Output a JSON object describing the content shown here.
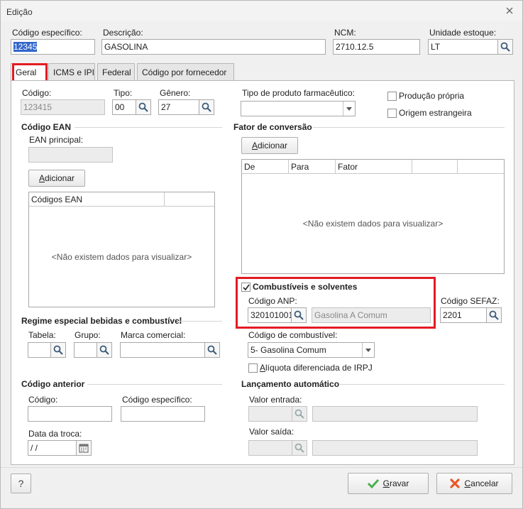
{
  "window": {
    "title": "Edição"
  },
  "header": {
    "codigo_especifico": {
      "label": "Código específico:",
      "value": "12345"
    },
    "descricao": {
      "label": "Descrição:",
      "value": "GASOLINA"
    },
    "ncm": {
      "label": "NCM:",
      "value": "2710.12.5"
    },
    "unidade_estoque": {
      "label": "Unidade estoque:",
      "value": "LT"
    }
  },
  "tabs": [
    {
      "label": "Geral"
    },
    {
      "label": "ICMS e IPI"
    },
    {
      "label": "Federal"
    },
    {
      "label": "Código por fornecedor"
    }
  ],
  "geral": {
    "codigo": {
      "label": "Código:",
      "value": "123415"
    },
    "tipo": {
      "label": "Tipo:",
      "value": "00"
    },
    "genero": {
      "label": "Gênero:",
      "value": "27"
    },
    "tipo_farmaceutico": {
      "label": "Tipo de produto farmacêutico:",
      "value": ""
    },
    "producao_propria": {
      "label": "Produção própria",
      "checked": false
    },
    "origem_estrangeira": {
      "label": "Origem estrangeira",
      "checked": false
    },
    "ean": {
      "title": "Código EAN",
      "principal_label": "EAN principal:",
      "add_first": "A",
      "add_rest": "dicionar",
      "column": "Códigos EAN",
      "empty": "<Não existem dados para visualizar>"
    },
    "fator": {
      "title": "Fator de conversão",
      "add_first": "A",
      "add_rest": "dicionar",
      "columns": [
        "De",
        "Para",
        "Fator",
        "",
        ""
      ],
      "empty": "<Não existem dados para visualizar>"
    },
    "combustiveis": {
      "label": "Combustíveis e solventes",
      "checked": true,
      "anp_label": "Código ANP:",
      "anp_value": "320101001",
      "anp_desc": "Gasolina A Comum",
      "sefaz_label": "Código SEFAZ:",
      "sefaz_value": "2201",
      "combustivel_label": "Código de combustível:",
      "combustivel_value": "5- Gasolina Comum",
      "aliquota_prefix": "A",
      "aliquota_rest": "líquota diferenciada de IRPJ",
      "aliquota_checked": false
    },
    "regime": {
      "title": "Regime especial bebidas e combustível",
      "tabela": "Tabela:",
      "grupo": "Grupo:",
      "marca": "Marca comercial:"
    },
    "anterior": {
      "title": "Código anterior",
      "codigo": "Código:",
      "codigo_especifico": "Código específico:",
      "data_label": "Data da troca:",
      "data_value": " / /"
    },
    "lancamento": {
      "title": "Lançamento automático",
      "valor_entrada": "Valor entrada:",
      "valor_saida": "Valor saída:"
    }
  },
  "footer": {
    "help": "?",
    "gravar_first": "G",
    "gravar_rest": "ravar",
    "cancelar_first": "C",
    "cancelar_rest": "ancelar"
  },
  "colors": {
    "highlight": "#e31b23",
    "selection": "#3366cc",
    "ok_green": "#4caf50",
    "cancel_red": "#e8572a"
  }
}
